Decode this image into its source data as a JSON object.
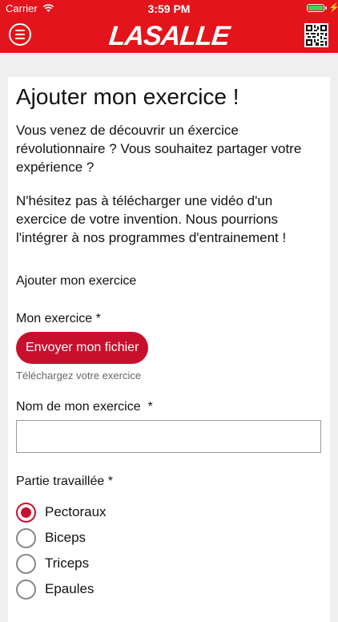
{
  "status_bar": {
    "carrier": "Carrier",
    "time": "3:59 PM"
  },
  "app_bar": {
    "logo_text": "LASALLE",
    "accent_color": "#e3141b"
  },
  "form": {
    "title": "Ajouter mon exercice !",
    "intro": "Vous venez de découvrir un éxercice révolutionnaire ? Vous souhaitez partager votre expérience ?",
    "intro2": "N'hésitez pas à télécharger une vidéo d'un exercice de votre invention. Nous pourrions l'intégrer à nos programmes d'entrainement !",
    "section_label": "Ajouter mon exercice",
    "exercise_label": "Mon exercice *",
    "upload_button": "Envoyer mon fichier",
    "upload_help": "Téléchargez votre exercice",
    "name_label": "Nom de mon exercice  *",
    "name_value": "",
    "part_label": "Partie travaillée *",
    "parts": [
      {
        "label": "Pectoraux",
        "selected": true
      },
      {
        "label": "Biceps",
        "selected": false
      },
      {
        "label": "Triceps",
        "selected": false
      },
      {
        "label": "Epaules",
        "selected": false
      }
    ],
    "button_color": "#c8102e"
  },
  "icons": [
    "wifi-icon",
    "battery-icon",
    "menu-icon",
    "qr-code-icon"
  ]
}
